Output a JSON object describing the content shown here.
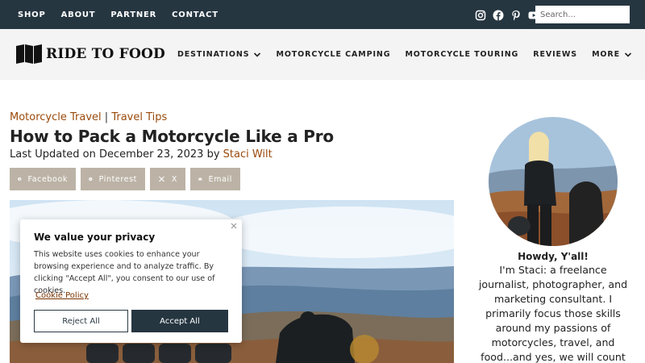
{
  "topbar": {
    "links": [
      "SHOP",
      "ABOUT",
      "PARTNER",
      "CONTACT"
    ],
    "social_icons": [
      "instagram-icon",
      "facebook-icon",
      "pinterest-icon",
      "youtube-icon"
    ],
    "search_placeholder": "Search..."
  },
  "header": {
    "logo_text": "RIDE TO FOOD",
    "nav": [
      {
        "label": "DESTINATIONS",
        "dropdown": true
      },
      {
        "label": "MOTORCYCLE CAMPING"
      },
      {
        "label": "MOTORCYCLE TOURING"
      },
      {
        "label": "REVIEWS"
      },
      {
        "label": "MORE",
        "dropdown": true
      }
    ]
  },
  "article": {
    "category_1": "Motorcycle Travel",
    "category_sep": " | ",
    "category_2": "Travel Tips",
    "title": "How to Pack a Motorcycle Like a Pro",
    "updated_prefix": "Last Updated on December 23, 2023 by ",
    "author": "Staci Wilt",
    "share": [
      {
        "label": "Facebook",
        "icon": "facebook-icon"
      },
      {
        "label": "Pinterest",
        "icon": "pinterest-icon"
      },
      {
        "label": "X",
        "icon": "x-icon"
      },
      {
        "label": "Email",
        "icon": "email-icon"
      }
    ]
  },
  "cookie": {
    "title": "We value your privacy",
    "body": "This website uses cookies to enhance your browsing experience and to analyze traffic. By clicking \"Accept All\", you consent to our use of cookies.",
    "policy_link": "Cookie Policy",
    "reject_label": "Reject All",
    "accept_label": "Accept All"
  },
  "sidebar": {
    "greeting": "Howdy, Y'all!",
    "bio": "I'm Staci: a freelance journalist, photographer, and marketing consultant. I primarily focus those skills around my passions of motorcycles, travel, and food...and yes, we will count margaritas and craft beer in"
  },
  "colors": {
    "topbar": "#263641",
    "accent": "#9a4a0b",
    "share_button": "#bcb3a6"
  }
}
